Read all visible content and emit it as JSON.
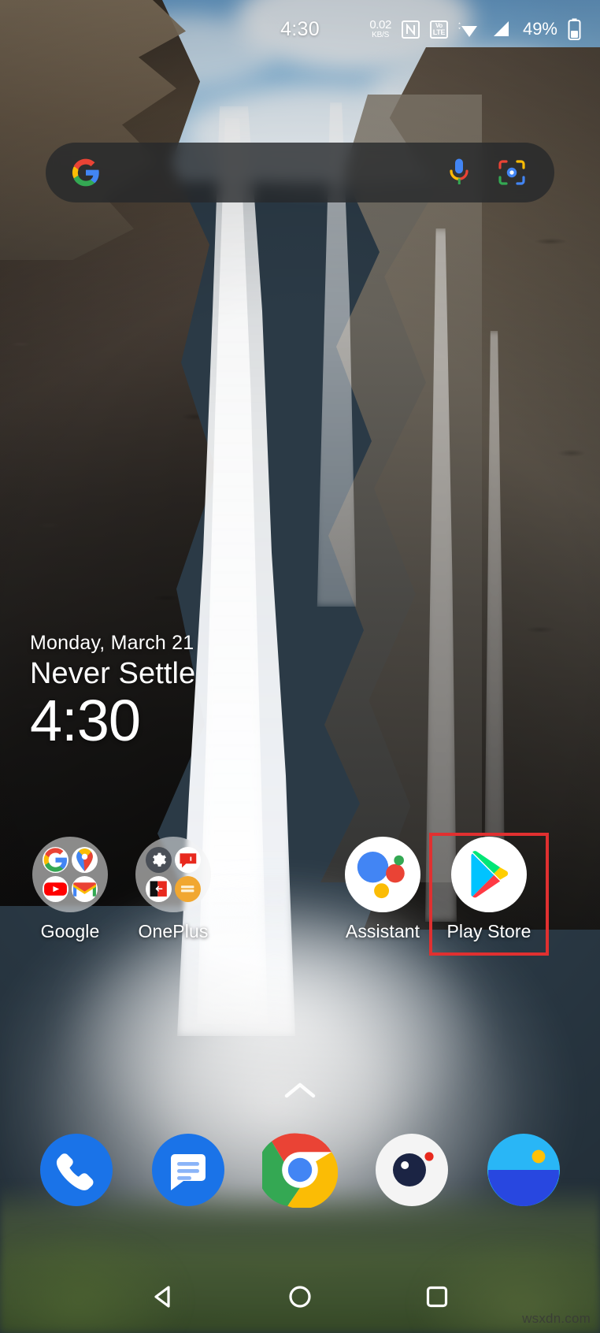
{
  "statusbar": {
    "time": "4:30",
    "net_speed_value": "0.02",
    "net_speed_unit": "KB/S",
    "nfc_icon": "nfc-icon",
    "volte_top": "Vo",
    "volte_bottom": "LTE",
    "wifi_icon": "wifi-icon",
    "signal_icon": "cellular-signal-icon",
    "battery_percent": "49%",
    "battery_icon": "battery-icon"
  },
  "search": {
    "google_logo": "google-g-icon",
    "mic_icon": "microphone-icon",
    "lens_icon": "google-lens-icon",
    "placeholder": ""
  },
  "clock_widget": {
    "date": "Monday, March 21",
    "tagline": "Never Settle",
    "time": "4:30"
  },
  "app_row": [
    {
      "label": "Google",
      "type": "folder",
      "apps": [
        "google-search-icon",
        "google-maps-icon",
        "youtube-icon",
        "gmail-icon"
      ]
    },
    {
      "label": "OnePlus",
      "type": "folder",
      "apps": [
        "settings-gear-icon",
        "oneplus-community-icon",
        "oneplus-switch-icon",
        "oneplus-notes-icon"
      ]
    },
    {
      "label": "Assistant",
      "type": "app",
      "icon": "google-assistant-icon"
    },
    {
      "label": "Play Store",
      "type": "app",
      "icon": "play-store-icon",
      "highlighted": true
    }
  ],
  "highlight": {
    "color": "#e03030",
    "target": "Play Store"
  },
  "drawer": {
    "arrow_icon": "chevron-up-icon"
  },
  "dock": [
    {
      "label": "Phone",
      "icon": "phone-icon"
    },
    {
      "label": "Messages",
      "icon": "messages-icon"
    },
    {
      "label": "Chrome",
      "icon": "chrome-icon"
    },
    {
      "label": "Camera",
      "icon": "camera-icon"
    },
    {
      "label": "Gallery",
      "icon": "gallery-icon"
    }
  ],
  "navbar": [
    {
      "label": "Back",
      "icon": "back-triangle-icon"
    },
    {
      "label": "Home",
      "icon": "home-circle-icon"
    },
    {
      "label": "Recents",
      "icon": "recents-square-icon"
    }
  ],
  "watermark": {
    "text": "wsxdn.com"
  },
  "wallpaper": {
    "description": "waterfall-cliff-photo",
    "sky_color": "#8cc0e6",
    "rock_color": "#6b5a4a"
  }
}
